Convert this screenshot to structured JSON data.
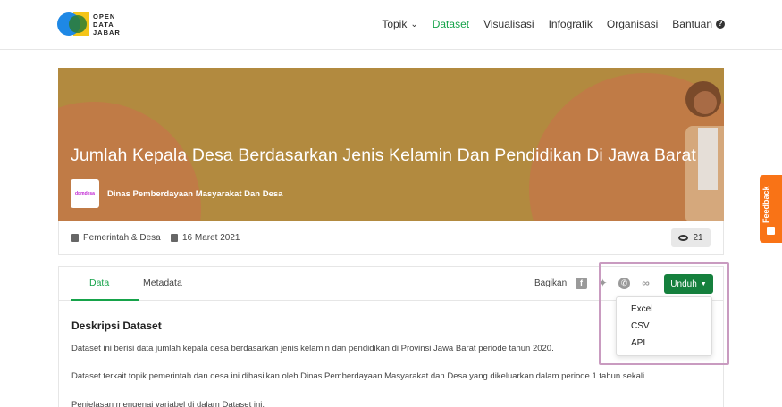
{
  "header": {
    "logo_lines": [
      "OPEN",
      "DATA",
      "JABAR"
    ],
    "nav": {
      "topik": "Topik",
      "dataset": "Dataset",
      "visualisasi": "Visualisasi",
      "infografik": "Infografik",
      "organisasi": "Organisasi",
      "bantuan": "Bantuan"
    }
  },
  "banner": {
    "title": "Jumlah Kepala Desa Berdasarkan Jenis Kelamin Dan Pendidikan Di Jawa Barat",
    "organization": "Dinas Pemberdayaan Masyarakat Dan Desa",
    "org_logo_text": "dpmdesa"
  },
  "meta": {
    "category": "Pemerintah & Desa",
    "date": "16 Maret 2021",
    "views": "21"
  },
  "tabs": {
    "data": "Data",
    "metadata": "Metadata"
  },
  "share": {
    "label": "Bagikan:",
    "icons": [
      "facebook-icon",
      "twitter-icon",
      "whatsapp-icon",
      "link-icon"
    ]
  },
  "download": {
    "label": "Unduh",
    "options": [
      "Excel",
      "CSV",
      "API"
    ]
  },
  "description": {
    "title": "Deskripsi Dataset",
    "p1": "Dataset ini berisi data jumlah kepala desa berdasarkan jenis kelamin dan pendidikan di Provinsi Jawa Barat periode tahun 2020.",
    "p2": "Dataset terkait topik pemerintah dan desa ini dihasilkan oleh Dinas Pemberdayaan Masyarakat dan Desa yang dikeluarkan dalam periode 1 tahun sekali.",
    "p3": "Penjelasan mengenai variabel di dalam Dataset ini:"
  },
  "feedback": {
    "label": "Feedback"
  },
  "colors": {
    "primary_green": "#15803d",
    "banner_gold": "#b28a3f",
    "banner_arc": "#c07b46",
    "feedback_orange": "#f97316"
  }
}
